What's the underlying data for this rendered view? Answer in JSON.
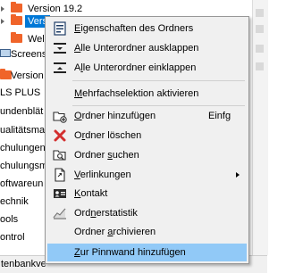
{
  "tree": {
    "items": [
      {
        "label": "Version 19.2"
      },
      {
        "label": "Vers",
        "selected": true
      },
      {
        "label": "Wel"
      },
      {
        "label": "Screens"
      },
      {
        "label": "Version"
      },
      {
        "label": "LS PLUS"
      },
      {
        "label": "undenblät"
      },
      {
        "label": "ualitätsmai"
      },
      {
        "label": "chulungen"
      },
      {
        "label": "chulungsm"
      },
      {
        "label": "oftwareun"
      },
      {
        "label": "echnik"
      },
      {
        "label": "ools"
      },
      {
        "label": "ontrol"
      }
    ],
    "status": "tenbankve"
  },
  "context_menu": {
    "items": [
      {
        "key": "properties",
        "pre": "",
        "acc": "E",
        "post": "igenschaften des Ordners",
        "icon": "folder-properties-icon"
      },
      {
        "key": "expand_all",
        "pre": "",
        "acc": "A",
        "post": "lle Unterordner ausklappen",
        "icon": "expand-all-icon"
      },
      {
        "key": "collapse_all",
        "pre": "A",
        "acc": "l",
        "post": "le Unterordner einklappen",
        "icon": "collapse-all-icon"
      },
      {
        "key": "multiselect",
        "pre": "",
        "acc": "M",
        "post": "ehrfachselektion aktivieren",
        "icon": ""
      },
      {
        "key": "add_folder",
        "pre": "",
        "acc": "O",
        "post": "rdner hinzufügen",
        "shortcut": "Einfg",
        "icon": "add-folder-icon"
      },
      {
        "key": "delete_folder",
        "pre": "O",
        "acc": "r",
        "post": "dner löschen",
        "icon": "delete-icon"
      },
      {
        "key": "search_folder",
        "pre": "Ordner ",
        "acc": "s",
        "post": "uchen",
        "icon": "search-folder-icon"
      },
      {
        "key": "links",
        "pre": "",
        "acc": "V",
        "post": "erlinkungen",
        "submenu": true,
        "icon": "links-icon"
      },
      {
        "key": "contact",
        "pre": "",
        "acc": "K",
        "post": "ontakt",
        "icon": "contact-card-icon"
      },
      {
        "key": "folder_stats",
        "pre": "Ord",
        "acc": "n",
        "post": "erstatistik",
        "icon": "statistics-icon"
      },
      {
        "key": "archive",
        "pre": "Ordner ",
        "acc": "a",
        "post": "rchivieren",
        "icon": ""
      },
      {
        "key": "pinboard",
        "pre": "",
        "acc": "Z",
        "post": "ur Pinnwand hinzufügen",
        "icon": "",
        "highlighted": true
      }
    ]
  },
  "colors": {
    "selection": "#0078d7",
    "menu_highlight": "#91c9f7",
    "folder": "#f0642a",
    "delete": "#d32f2f"
  }
}
